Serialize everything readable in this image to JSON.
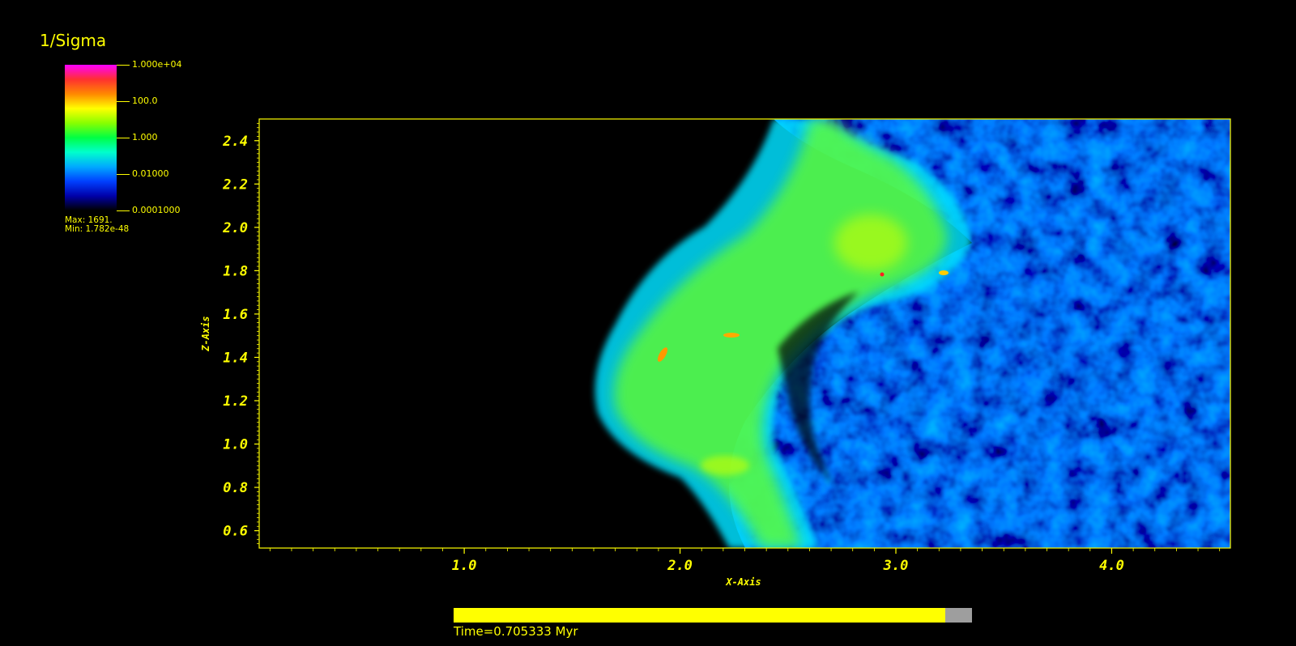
{
  "colorbar": {
    "title": "1/Sigma",
    "tick_labels": [
      "1.000e+04",
      "100.0",
      "1.000",
      "0.01000",
      "0.0001000"
    ],
    "max_label": "Max:  1691.",
    "min_label": "Min:  1.782e-48",
    "colors": [
      "#ff00ff",
      "#ff3030",
      "#ff8800",
      "#ffff00",
      "#88ff00",
      "#00ff44",
      "#00ffcc",
      "#00aaff",
      "#0040ff",
      "#0000aa",
      "#000000"
    ]
  },
  "chart_data": {
    "type": "heatmap",
    "title": "1/Sigma",
    "xlabel": "X-Axis",
    "ylabel": "Z-Axis",
    "xlim": [
      0.05,
      4.55
    ],
    "ylim": [
      0.52,
      2.5
    ],
    "x_ticks": [
      "1.0",
      "2.0",
      "3.0",
      "4.0"
    ],
    "y_ticks": [
      "2.4",
      "2.2",
      "2.0",
      "1.8",
      "1.6",
      "1.4",
      "1.2",
      "1.0",
      "0.8",
      "0.6"
    ],
    "color_scale": "log",
    "color_range": [
      0.0001,
      10000
    ],
    "data_max": 1691,
    "data_min": 1.782e-48
  },
  "footer": {
    "time_label": "Time=0.705333 Myr",
    "progress": 0.948
  }
}
